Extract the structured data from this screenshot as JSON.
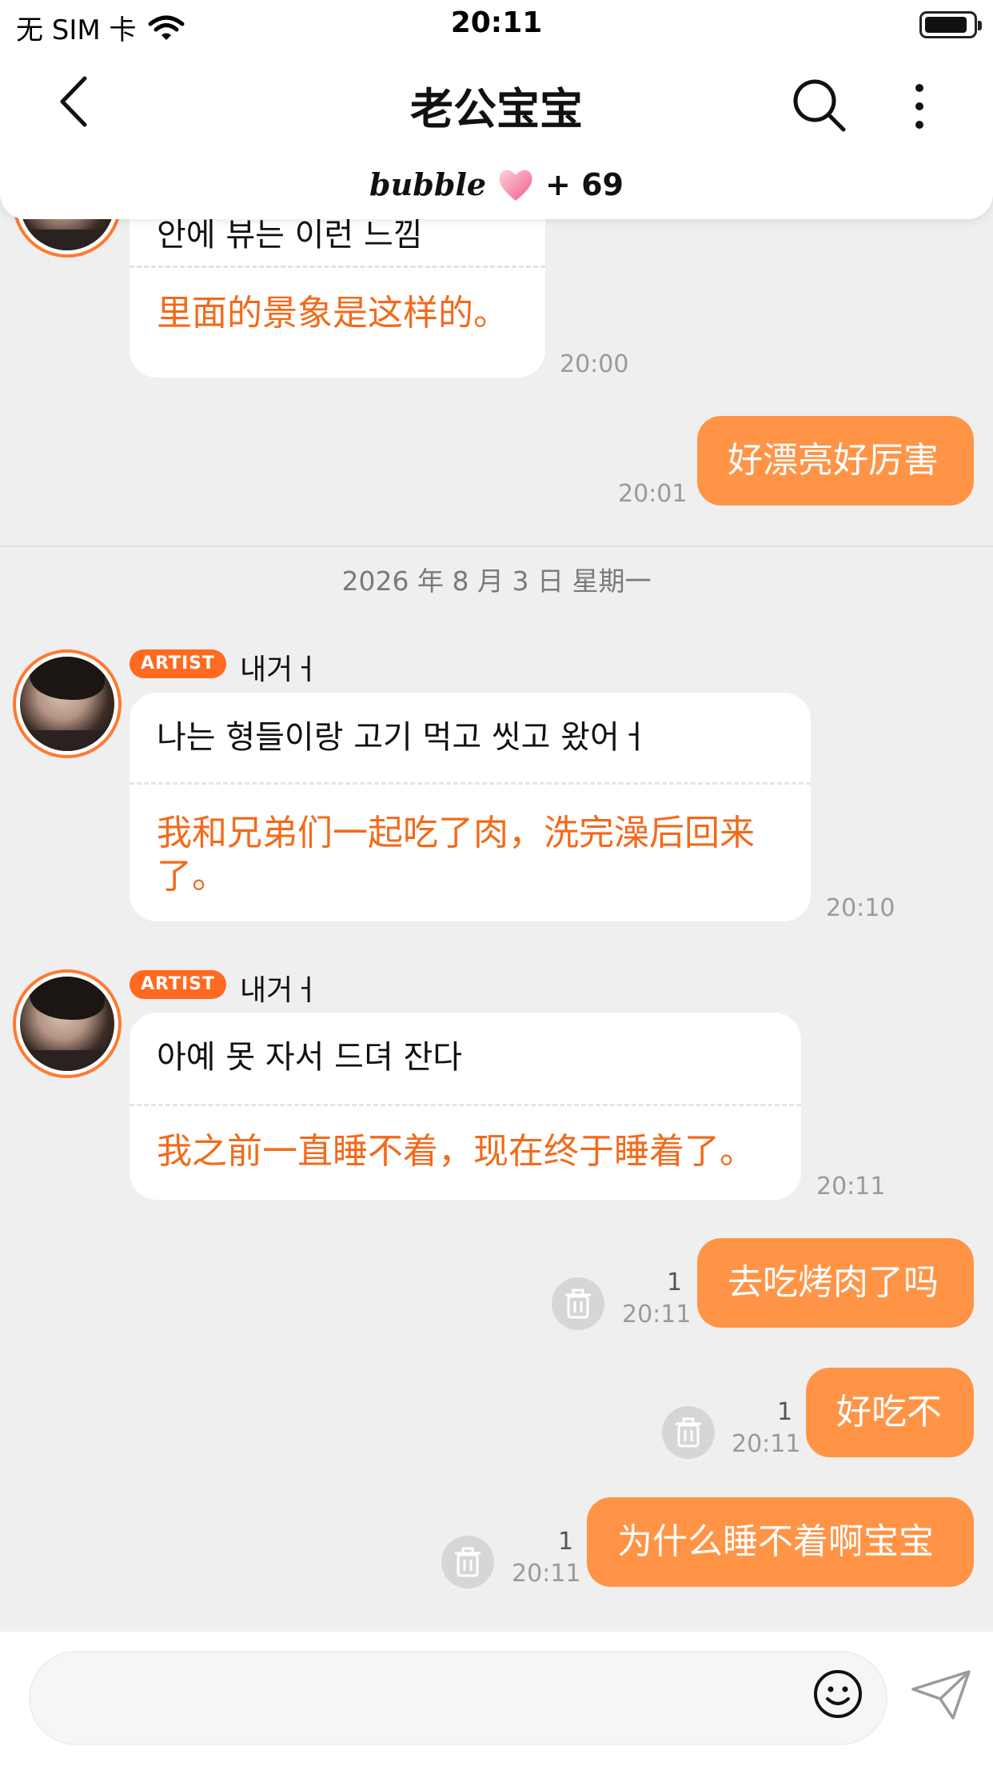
{
  "status_bar": {
    "carrier": "无 SIM 卡",
    "time": "20:11"
  },
  "header": {
    "title": "老公宝宝",
    "bubble_logo": "bubble",
    "bubble_count": "+ 69"
  },
  "messages": {
    "m1": {
      "korean": "안에 뷰는 이런 느낌",
      "chinese": "里面的景象是这样的。",
      "time": "20:00"
    },
    "s1": {
      "text": "好漂亮好厉害",
      "time": "20:01"
    },
    "date_divider": "2026 年 8 月 3 日 星期一",
    "m2": {
      "badge": "ARTIST",
      "sender": "내거ㅓ",
      "korean": "나는 형들이랑 고기 먹고 씻고 왔어ㅓ",
      "chinese": "我和兄弟们一起吃了肉，洗完澡后回来了。",
      "time": "20:10"
    },
    "m3": {
      "badge": "ARTIST",
      "sender": "내거ㅓ",
      "korean": "아예 못 자서 드뎌 잔다",
      "chinese": "我之前一直睡不着，现在终于睡着了。",
      "time": "20:11"
    },
    "s2": {
      "text": "去吃烤肉了吗",
      "read": "1",
      "time": "20:11"
    },
    "s3": {
      "text": "好吃不",
      "read": "1",
      "time": "20:11"
    },
    "s4": {
      "text": "为什么睡不着啊宝宝",
      "read": "1",
      "time": "20:11"
    }
  },
  "input": {
    "placeholder": ""
  },
  "colors": {
    "accent": "#ff9447",
    "badge": "#ff6a20",
    "translation": "#f26a1b",
    "background": "#efefef"
  },
  "icons": [
    "back-icon",
    "search-icon",
    "more-icon",
    "heart-icon",
    "trash-icon",
    "emoji-icon",
    "send-icon",
    "wifi-icon",
    "battery-icon"
  ]
}
